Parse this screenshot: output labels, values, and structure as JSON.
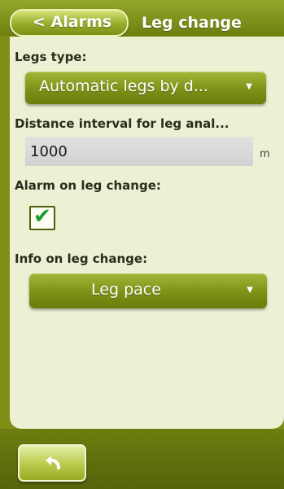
{
  "header": {
    "back_label": "< Alarms",
    "title": "Leg change"
  },
  "legs_type": {
    "label": "Legs type:",
    "selected": "Automatic legs by d...",
    "arrow_icon": "dropdown-arrow-icon"
  },
  "distance_interval": {
    "label": "Distance interval for leg anal...",
    "value": "1000",
    "unit": "m"
  },
  "alarm": {
    "label": "Alarm on leg change:",
    "checked": true,
    "check_glyph": "✔"
  },
  "info": {
    "label": "Info on leg change:",
    "selected": "Leg pace",
    "arrow_icon": "dropdown-arrow-icon"
  },
  "footer": {
    "undo_icon": "undo-icon"
  },
  "colors": {
    "device_green": "#7f8f16",
    "panel_bg": "#edf1d4",
    "button_green": "#7b8e14",
    "check_green": "#199a2a"
  }
}
